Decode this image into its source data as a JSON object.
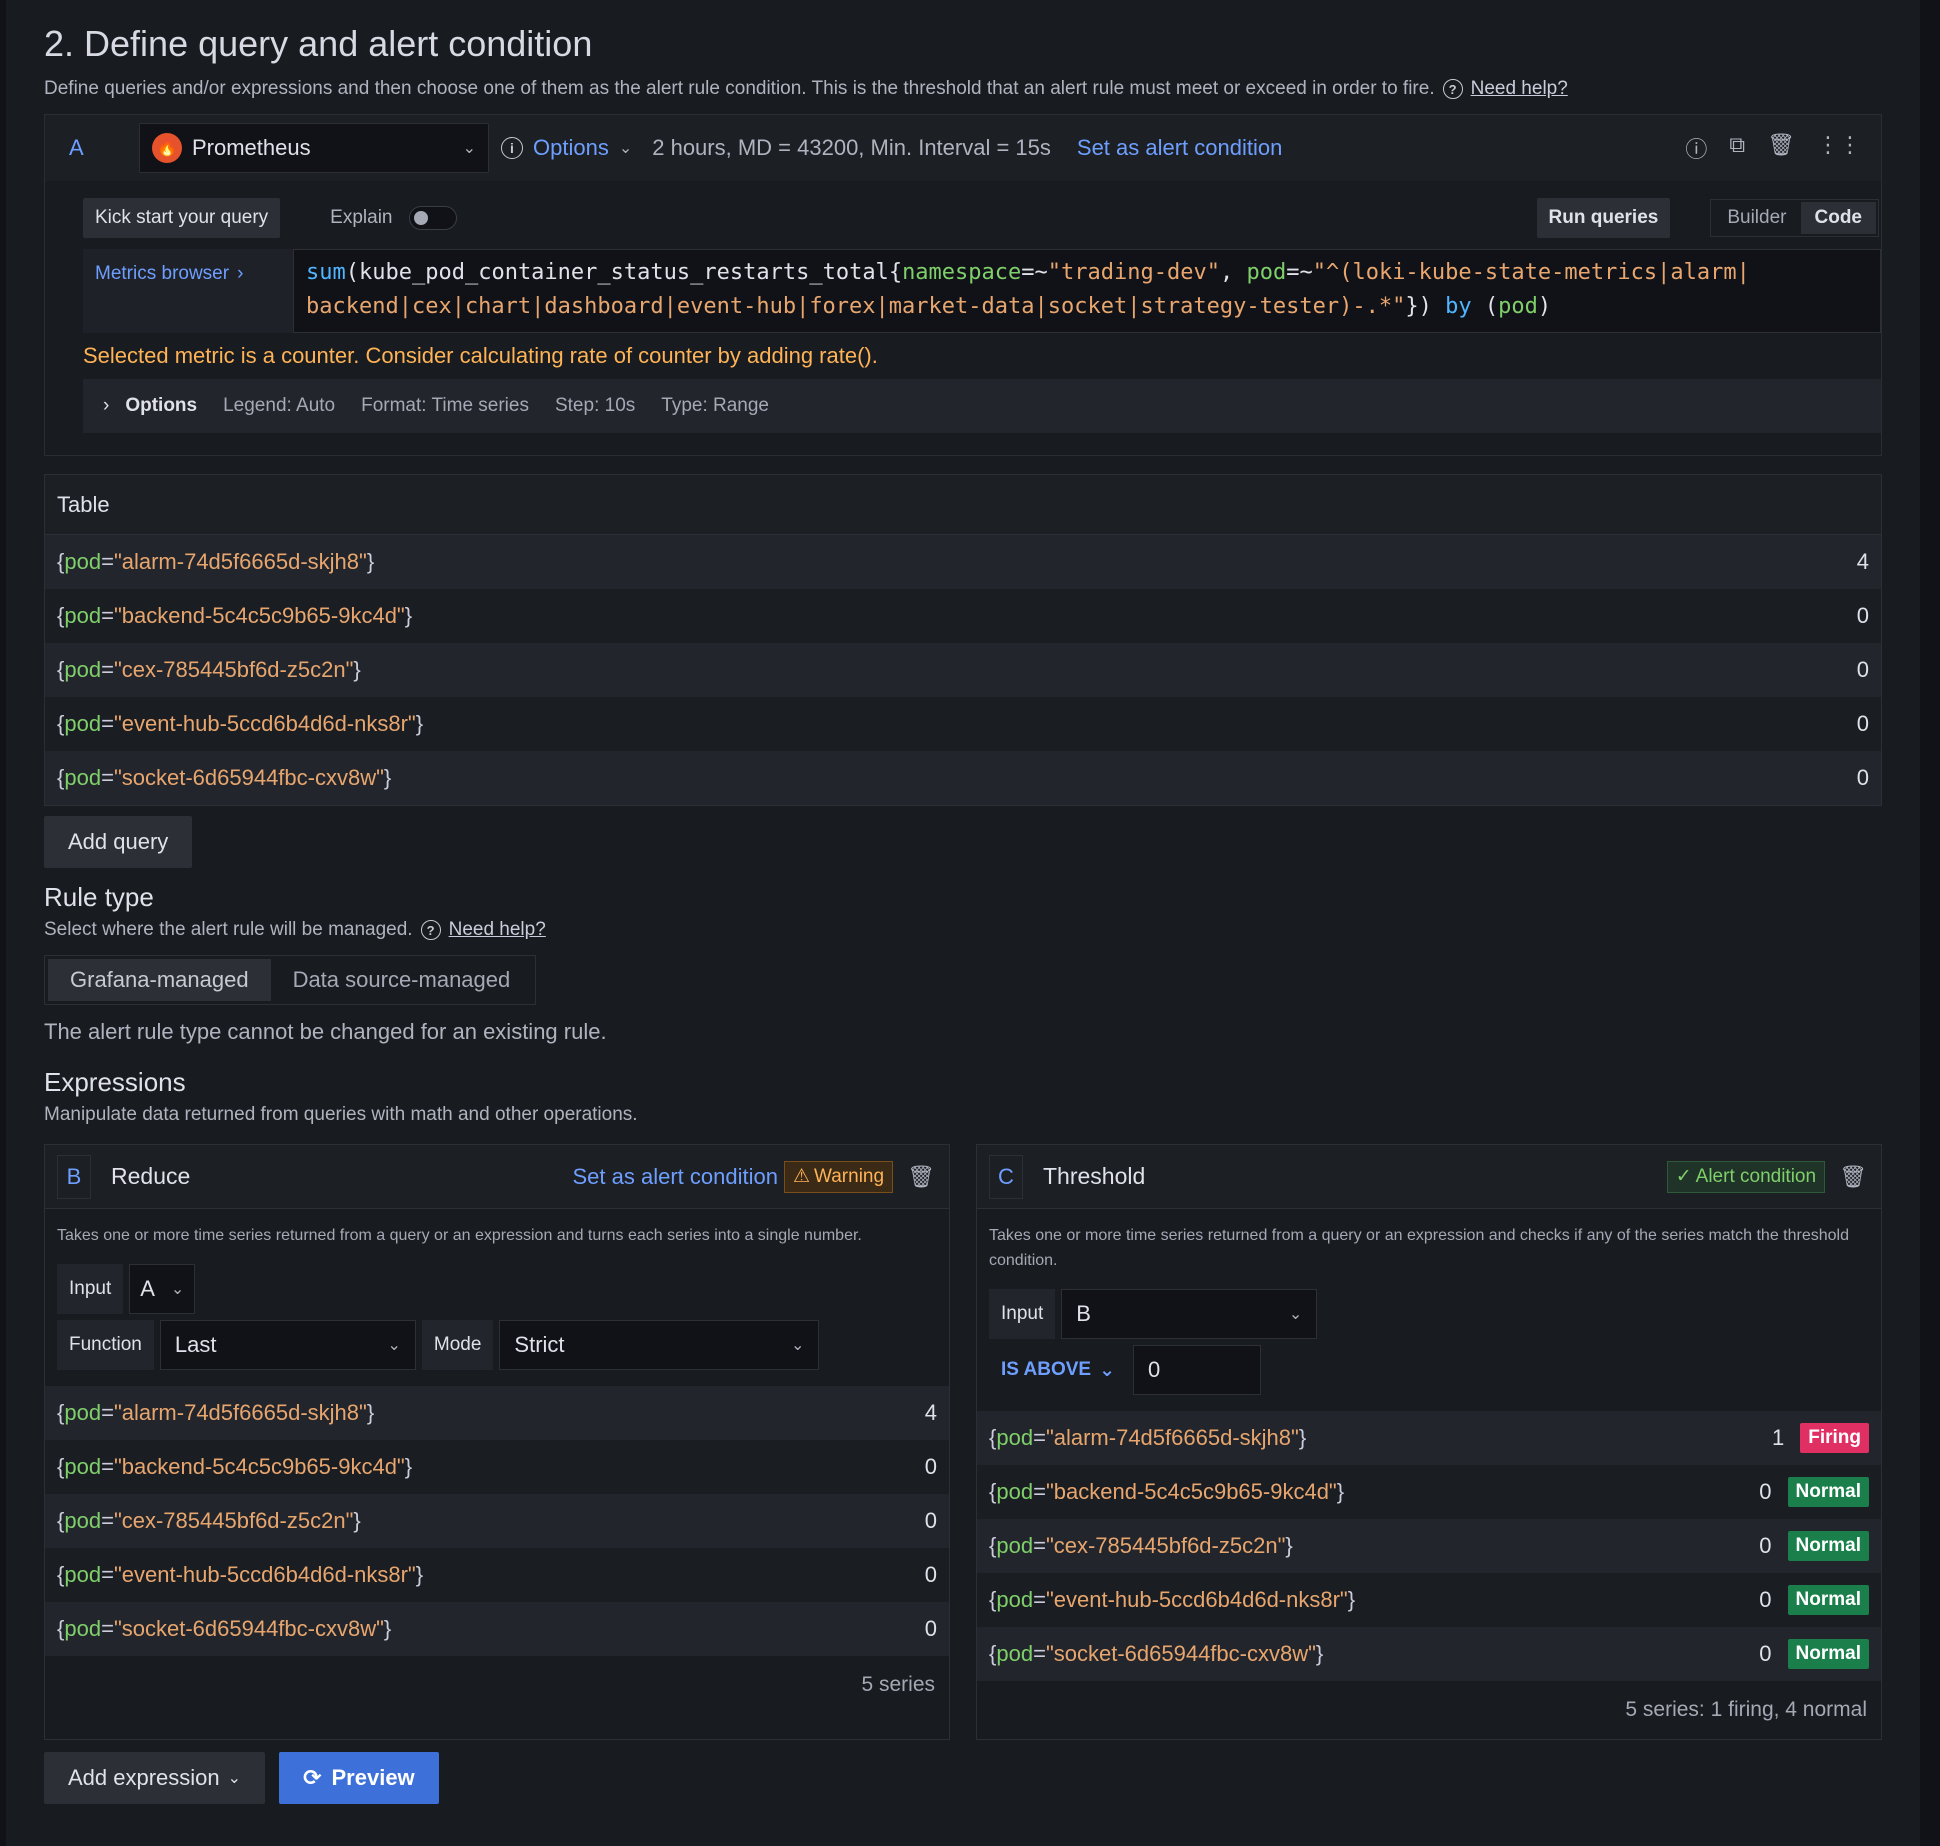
{
  "section": {
    "title": "2. Define query and alert condition",
    "description": "Define queries and/or expressions and then choose one of them as the alert rule condition. This is the threshold that an alert rule must meet or exceed in order to fire.",
    "help_link": "Need help?"
  },
  "query": {
    "ref": "A",
    "datasource": "Prometheus",
    "options_label": "Options",
    "meta": "2 hours, MD = 43200, Min. Interval = 15s",
    "set_condition": "Set as alert condition",
    "kick_start": "Kick start your query",
    "explain_label": "Explain",
    "run_queries": "Run queries",
    "mode_builder": "Builder",
    "mode_code": "Code",
    "metrics_browser": "Metrics browser",
    "expr": {
      "fn": "sum",
      "metric": "kube_pod_container_status_restarts_total",
      "l1": "namespace",
      "op1": "=~",
      "v1": "\"trading-dev\"",
      "l2": "pod",
      "op2": "=~",
      "v2a": "\"^(loki-kube-state-metrics|alarm|",
      "v2b": "backend|cex|chart|dashboard|event-hub|forex|market-data|socket|strategy-tester)-.*\"",
      "by": "by",
      "group": "pod"
    },
    "warning": "Selected metric is a counter. Consider calculating rate of counter by adding rate().",
    "options_row": {
      "title": "Options",
      "legend": "Legend: Auto",
      "format": "Format: Time series",
      "step": "Step: 10s",
      "type": "Type: Range"
    }
  },
  "table": {
    "title": "Table",
    "label_key": "pod",
    "rows": [
      {
        "pod": "\"alarm-74d5f6665d-skjh8\"",
        "value": "4"
      },
      {
        "pod": "\"backend-5c4c5c9b65-9kc4d\"",
        "value": "0"
      },
      {
        "pod": "\"cex-785445bf6d-z5c2n\"",
        "value": "0"
      },
      {
        "pod": "\"event-hub-5ccd6b4d6d-nks8r\"",
        "value": "0"
      },
      {
        "pod": "\"socket-6d65944fbc-cxv8w\"",
        "value": "0"
      }
    ]
  },
  "add_query": "Add query",
  "rule_type": {
    "title": "Rule type",
    "description": "Select where the alert rule will be managed.",
    "help_link": "Need help?",
    "options": [
      "Grafana-managed",
      "Data source-managed"
    ],
    "note": "The alert rule type cannot be changed for an existing rule."
  },
  "expressions": {
    "title": "Expressions",
    "description": "Manipulate data returned from queries with math and other operations.",
    "reduce": {
      "ref": "B",
      "name": "Reduce",
      "set_condition": "Set as alert condition",
      "warning": "Warning",
      "description": "Takes one or more time series returned from a query or an expression and turns each series into a single number.",
      "input_label": "Input",
      "input_value": "A",
      "function_label": "Function",
      "function_value": "Last",
      "mode_label": "Mode",
      "mode_value": "Strict",
      "rows": [
        {
          "pod": "\"alarm-74d5f6665d-skjh8\"",
          "value": "4"
        },
        {
          "pod": "\"backend-5c4c5c9b65-9kc4d\"",
          "value": "0"
        },
        {
          "pod": "\"cex-785445bf6d-z5c2n\"",
          "value": "0"
        },
        {
          "pod": "\"event-hub-5ccd6b4d6d-nks8r\"",
          "value": "0"
        },
        {
          "pod": "\"socket-6d65944fbc-cxv8w\"",
          "value": "0"
        }
      ],
      "footer": "5 series"
    },
    "threshold": {
      "ref": "C",
      "name": "Threshold",
      "badge": "Alert condition",
      "description": "Takes one or more time series returned from a query or an expression and checks if any of the series match the threshold condition.",
      "input_label": "Input",
      "input_value": "B",
      "comparator": "IS ABOVE",
      "threshold_value": "0",
      "rows": [
        {
          "pod": "\"alarm-74d5f6665d-skjh8\"",
          "value": "1",
          "state": "Firing"
        },
        {
          "pod": "\"backend-5c4c5c9b65-9kc4d\"",
          "value": "0",
          "state": "Normal"
        },
        {
          "pod": "\"cex-785445bf6d-z5c2n\"",
          "value": "0",
          "state": "Normal"
        },
        {
          "pod": "\"event-hub-5ccd6b4d6d-nks8r\"",
          "value": "0",
          "state": "Normal"
        },
        {
          "pod": "\"socket-6d65944fbc-cxv8w\"",
          "value": "0",
          "state": "Normal"
        }
      ],
      "footer": "5 series: 1 firing, 4 normal"
    }
  },
  "add_expression": "Add expression",
  "preview": "Preview",
  "icons": {
    "help": "help-circle-icon",
    "copy": "copy-icon",
    "trash": "trash-icon",
    "drag": "drag-handle-icon",
    "refresh": "refresh-icon"
  },
  "colors": {
    "accent": "#6e9fff",
    "warning": "#ffb357",
    "firing": "#e02f63",
    "normal": "#1a7f4b",
    "primary_button": "#3d71d9"
  }
}
